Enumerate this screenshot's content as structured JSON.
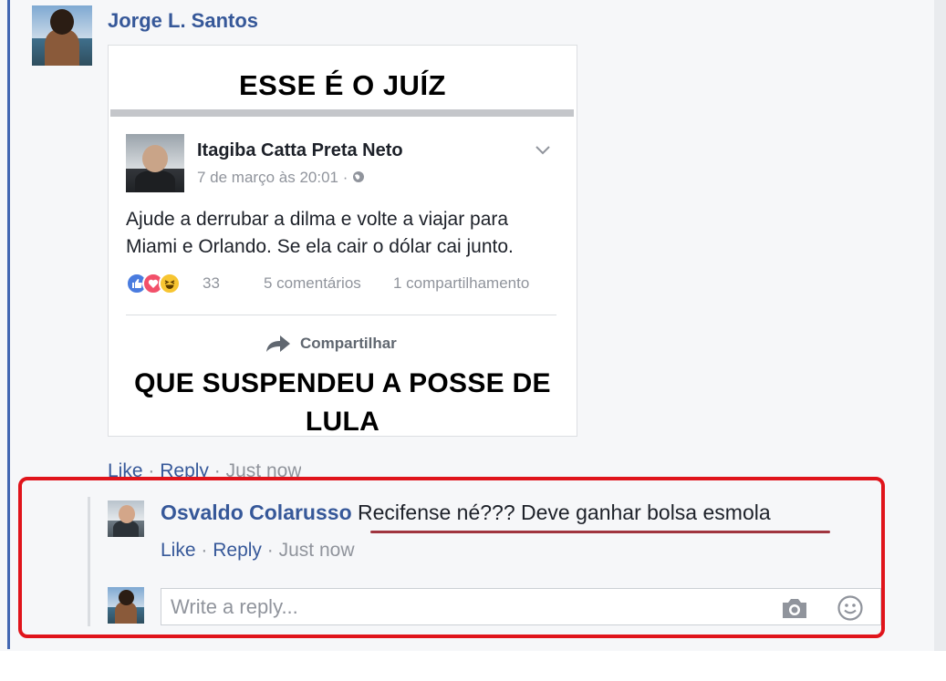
{
  "post": {
    "author_name": "Jorge L. Santos",
    "image": {
      "title_top": "ESSE É O JUÍZ",
      "title_bottom": "QUE SUSPENDEU A POSSE DE LULA",
      "inner_post": {
        "author": "Itagiba Catta Preta Neto",
        "meta": "7 de março às 20:01 · ",
        "text": "Ajude a derrubar a dilma e volte a viajar para Miami e Orlando. Se ela cair o dólar cai junto.",
        "reaction_count": "33",
        "comments": "5 comentários",
        "shares": "1 compartilhamento",
        "share_label": "Compartilhar"
      }
    },
    "actions": {
      "like": "Like",
      "reply": "Reply",
      "sep": "·",
      "time": "Just now"
    }
  },
  "reply": {
    "author": "Osvaldo Colarusso",
    "text": "Recifense né??? Deve ganhar bolsa esmola",
    "actions": {
      "like": "Like",
      "reply": "Reply",
      "sep": "·",
      "time": "Just now"
    }
  },
  "composer": {
    "placeholder": "Write a reply..."
  },
  "colors": {
    "link": "#365899",
    "highlight_border": "#e0141b",
    "underline": "#a0353f"
  },
  "icons": {
    "camera": "camera-icon",
    "smiley": "smiley-icon",
    "share": "share-arrow-icon",
    "globe": "globe-icon",
    "chevron": "chevron-down-icon"
  }
}
